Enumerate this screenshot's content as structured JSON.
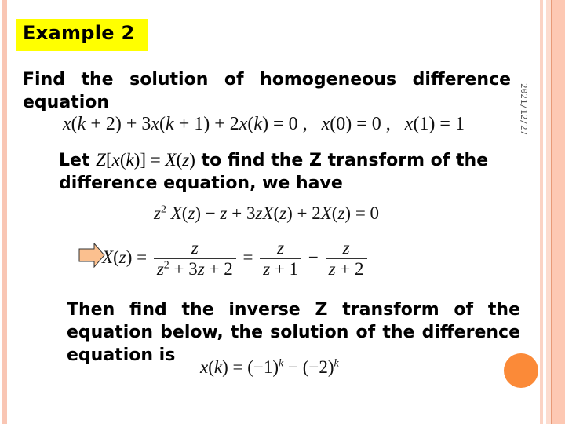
{
  "slide": {
    "title": "Example 2",
    "date": "2021/12/27",
    "intro": "Find the solution of homogeneous difference equation",
    "equation_given": {
      "main": "x(k+2) + 3x(k+1) + 2x(k) = 0",
      "init1": "x(0) = 0",
      "init2": "x(1) = 1"
    },
    "let_prefix": "Let",
    "let_math": "Z[x(k)] = X(z)",
    "let_suffix": "to find the Z transform of the difference equation, we have",
    "z_transform_eq": "z² X(z) − z + 3zX(z) + 2X(z) = 0",
    "solution_lhs": "X(z) =",
    "frac1": {
      "num": "z",
      "den": "z² + 3z + 2"
    },
    "frac2": {
      "num": "z",
      "den": "z + 1"
    },
    "frac3": {
      "num": "z",
      "den": "z + 2"
    },
    "conclusion": "Then find the inverse Z transform of the equation below, the solution of the difference equation is",
    "final_solution": "x(k) = (−1)^k − (−2)^k"
  },
  "colors": {
    "title_bg": "#ffff00",
    "stripe": "#f9c6b4",
    "arrow_fill": "#fbc08f",
    "circle": "#fb8a38"
  }
}
